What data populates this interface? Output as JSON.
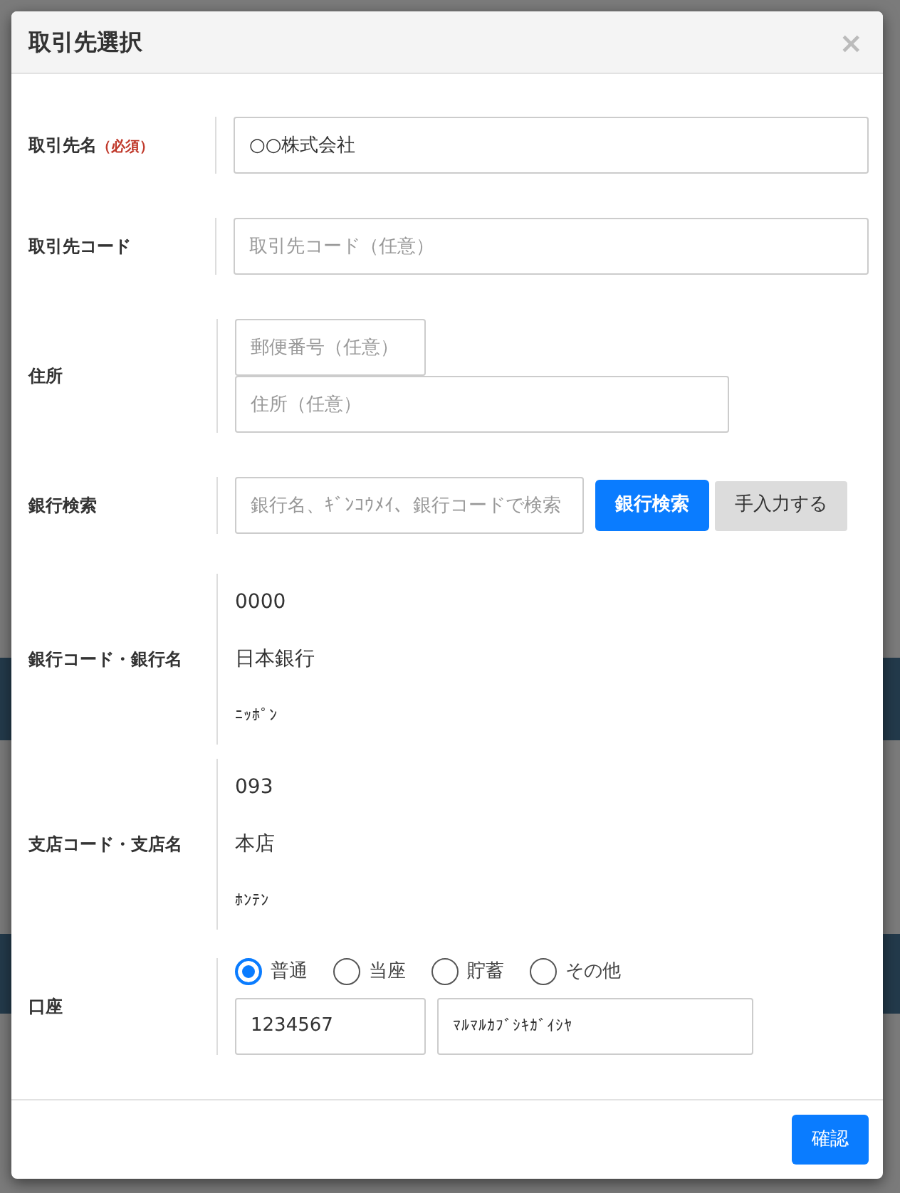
{
  "dialog": {
    "title": "取引先選択",
    "close": "×"
  },
  "rows": [
    {
      "kind": "input",
      "label": "取引先名",
      "required": "（必須）",
      "value": "○○株式会社"
    },
    {
      "kind": "input",
      "label": "取引先コード",
      "placeholder": "取引先コード（任意）"
    },
    {
      "kind": "address",
      "label": "住所",
      "postal_placeholder": "郵便番号（任意）",
      "address_placeholder": "住所（任意）"
    },
    {
      "kind": "bank_search",
      "label": "銀行検索",
      "placeholder": "銀行名、ｷﾞﾝｺｳﾒｲ、銀行コードで検索",
      "search_button": "銀行検索",
      "manual_button": "手入力する"
    },
    {
      "kind": "info",
      "label": "銀行コード・銀行名",
      "code": "0000",
      "name": "日本銀行",
      "kana": "ﾆｯﾎﾟﾝ"
    },
    {
      "kind": "info",
      "label": "支店コード・支店名",
      "code": "093",
      "name": "本店",
      "kana": "ﾎﾝﾃﾝ"
    },
    {
      "kind": "account",
      "label": "口座",
      "types": [
        {
          "label": "普通",
          "selected": true
        },
        {
          "label": "当座",
          "selected": false
        },
        {
          "label": "貯蓄",
          "selected": false
        },
        {
          "label": "その他",
          "selected": false
        }
      ],
      "number": "1234567",
      "holder": "ﾏﾙﾏﾙｶﾌﾞｼｷｶﾞｲｼﾔ"
    }
  ],
  "footer": {
    "confirm_button": "確認"
  }
}
